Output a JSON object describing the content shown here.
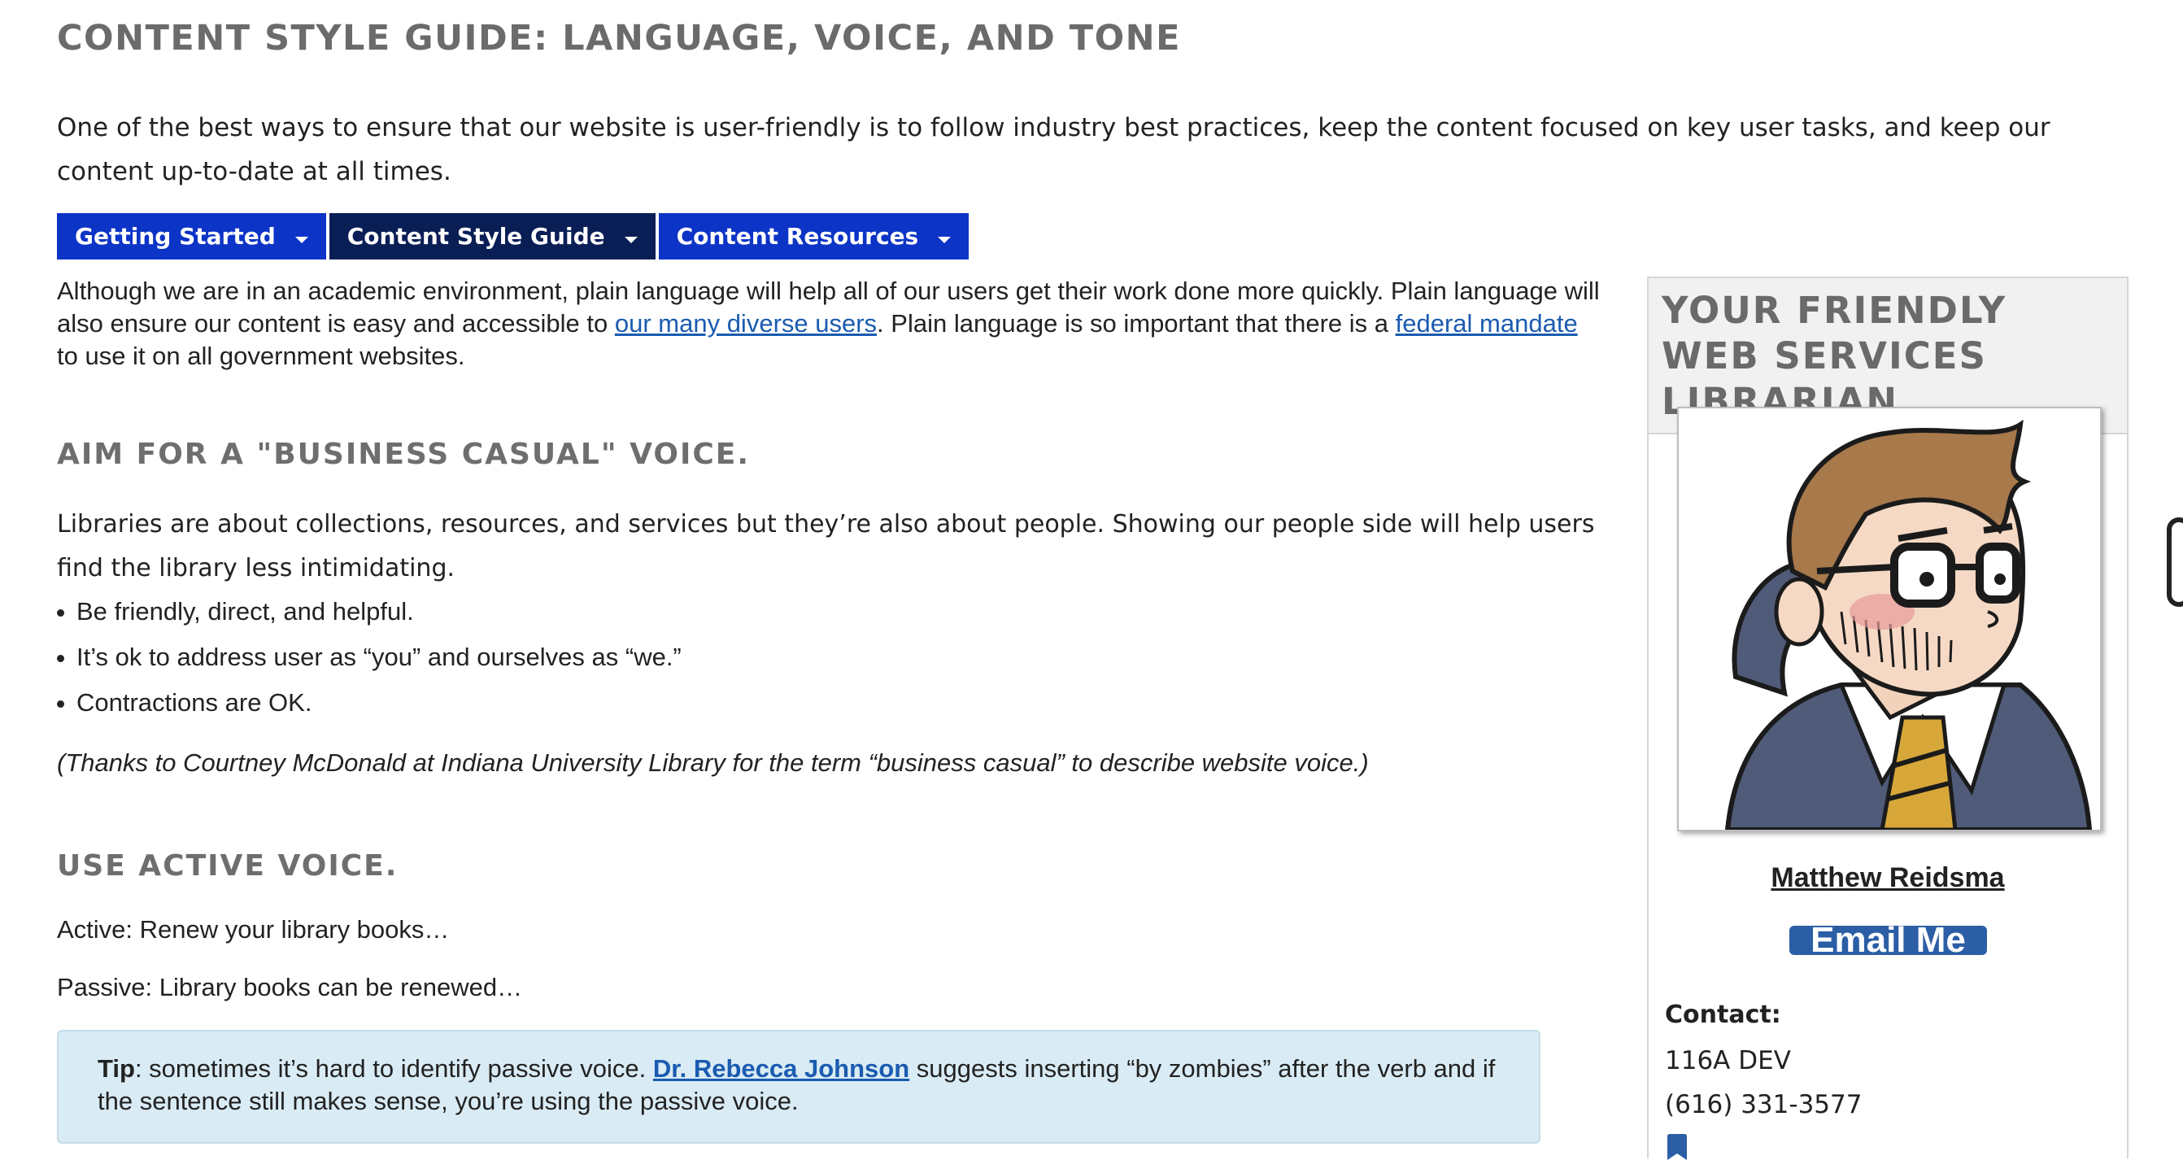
{
  "page": {
    "title": "CONTENT STYLE GUIDE: LANGUAGE, VOICE, AND TONE",
    "intro": "One of the best ways to ensure that our website is user-friendly is to follow industry best practices, keep the content focused on key user tasks, and keep our content up-to-date at all times."
  },
  "tabs": [
    {
      "label": "Getting Started"
    },
    {
      "label": "Content Style Guide"
    },
    {
      "label": "Content Resources"
    }
  ],
  "main": {
    "plain_language": {
      "part1": "Although we are in an academic environment, plain language will help all of our users get their work done more quickly. Plain language will also ensure our content is easy and accessible to ",
      "link1": "our many diverse users",
      "part2": ". Plain language is so important that there is a ",
      "link2": "federal mandate",
      "part3": " to use it on all government websites."
    },
    "business_casual": {
      "heading": "AIM FOR A \"BUSINESS CASUAL\" VOICE.",
      "body": "Libraries are about collections, resources, and services but they’re also about people. Showing our people side will help users find the library less intimidating.",
      "bullets": [
        "Be friendly, direct, and helpful.",
        "It’s ok to address user as “you” and ourselves as “we.”",
        "Contractions are OK."
      ],
      "thanks": "(Thanks to Courtney McDonald at Indiana University Library for the term “business casual” to describe website voice.)"
    },
    "active_voice": {
      "heading": "USE ACTIVE VOICE.",
      "active": "Active: Renew your library books…",
      "passive": "Passive: Library books can be renewed…",
      "tip_label": "Tip",
      "tip_part1": ": sometimes it’s hard to identify passive voice.  ",
      "tip_link": "Dr. Rebecca Johnson",
      "tip_part2": " suggests inserting “by zombies” after the verb and if the sentence still makes sense, you’re using the passive voice."
    }
  },
  "sidebar": {
    "heading": "YOUR FRIENDLY WEB SERVICES LIBRARIAN",
    "name": "Matthew Reidsma",
    "email_button": "Email Me",
    "contact_label": "Contact:",
    "office": "116A DEV",
    "phone": "(616) 331-3577"
  },
  "colors": {
    "tab_blue": "#0c34c6",
    "tab_active": "#0a1e56",
    "link": "#1a5bb0",
    "tip_bg": "#d9ebf4",
    "heading_gray": "#6e6e6e"
  }
}
